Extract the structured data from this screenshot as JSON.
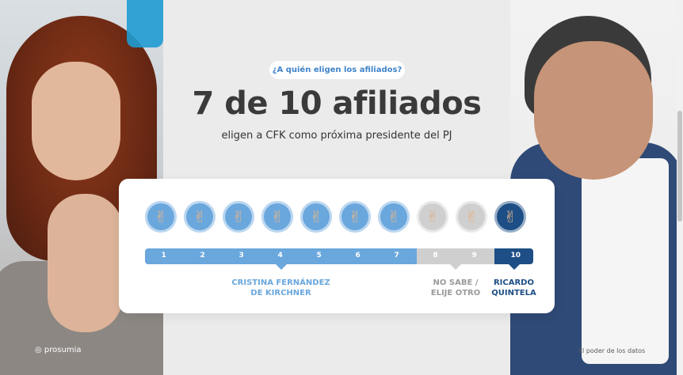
{
  "pill": "¿A quién eligen los afiliados?",
  "headline": "7 de 10 afiliados",
  "subhead": "eligen a CFK como próxima presidente del PJ",
  "scale": {
    "numbers": [
      "1",
      "2",
      "3",
      "4",
      "5",
      "6",
      "7",
      "8",
      "9",
      "10"
    ],
    "groups": [
      {
        "label_line1": "CRISTINA FERNÁNDEZ",
        "label_line2": "DE KIRCHNER",
        "count": 7,
        "color": "#6aa7dd"
      },
      {
        "label_line1": "NO SABE /",
        "label_line2": "ELIJE OTRO",
        "count": 2,
        "color": "#cfcfcf"
      },
      {
        "label_line1": "RICARDO",
        "label_line2": "QUINTELA",
        "count": 1,
        "color": "#1d4e85"
      }
    ]
  },
  "footer": {
    "left": "prosumia",
    "right": "El poder de los datos"
  },
  "icon": "peace-sign-hand-icon"
}
